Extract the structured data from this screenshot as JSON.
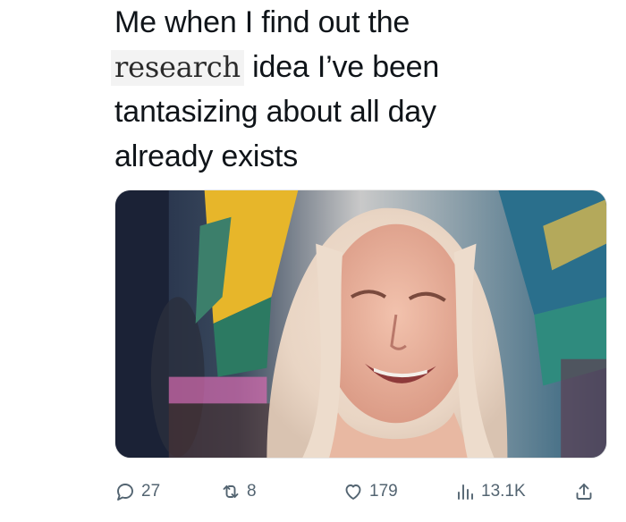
{
  "tweet": {
    "text_lines": [
      "Me when I find out the",
      "idea I’ve been",
      "tantasizing about all day",
      "already exists"
    ],
    "pasted_word": "research"
  },
  "media": {
    "alt": "crying-woman-meme-image"
  },
  "actions": {
    "replies": "27",
    "reposts": "8",
    "likes": "179",
    "views": "13.1K"
  },
  "icons": {
    "reply": "reply-icon",
    "repost": "repost-icon",
    "like": "heart-icon",
    "views": "views-chart-icon",
    "share": "share-icon"
  },
  "colors": {
    "text": "#0f1419",
    "muted": "#536471"
  }
}
